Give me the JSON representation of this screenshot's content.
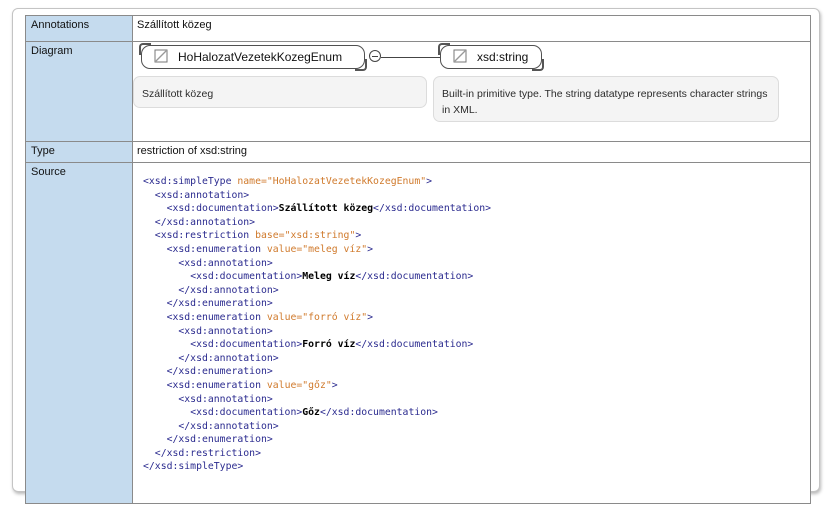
{
  "rows": {
    "annotations": {
      "label": "Annotations",
      "value": "Szállított közeg"
    },
    "diagram": {
      "label": "Diagram",
      "type_name": "HoHalozatVezetekKozegEnum",
      "type_doc": "Szállított közeg",
      "base_type": "xsd:string",
      "base_doc": "Built-in primitive type. The string datatype represents character strings in XML."
    },
    "type": {
      "label": "Type",
      "value": "restriction of xsd:string"
    },
    "source": {
      "label": "Source"
    }
  },
  "source_lines": [
    {
      "indent": "",
      "parts": [
        [
          "tag",
          "<xsd:simpleType "
        ],
        [
          "attr",
          "name="
        ],
        [
          "attr",
          "\"HoHalozatVezetekKozegEnum\""
        ],
        [
          "tag",
          ">"
        ]
      ]
    },
    {
      "indent": "  ",
      "parts": [
        [
          "tag",
          "<xsd:annotation>"
        ]
      ]
    },
    {
      "indent": "    ",
      "parts": [
        [
          "tag",
          "<xsd:documentation>"
        ],
        [
          "txt",
          "Szállított közeg"
        ],
        [
          "tag",
          "</xsd:documentation>"
        ]
      ]
    },
    {
      "indent": "  ",
      "parts": [
        [
          "tag",
          "</xsd:annotation>"
        ]
      ]
    },
    {
      "indent": "  ",
      "parts": [
        [
          "tag",
          "<xsd:restriction "
        ],
        [
          "attr",
          "base="
        ],
        [
          "attr",
          "\"xsd:string\""
        ],
        [
          "tag",
          ">"
        ]
      ]
    },
    {
      "indent": "    ",
      "parts": [
        [
          "tag",
          "<xsd:enumeration "
        ],
        [
          "attr",
          "value="
        ],
        [
          "attr",
          "\"meleg víz\""
        ],
        [
          "tag",
          ">"
        ]
      ]
    },
    {
      "indent": "      ",
      "parts": [
        [
          "tag",
          "<xsd:annotation>"
        ]
      ]
    },
    {
      "indent": "        ",
      "parts": [
        [
          "tag",
          "<xsd:documentation>"
        ],
        [
          "txt",
          "Meleg víz"
        ],
        [
          "tag",
          "</xsd:documentation>"
        ]
      ]
    },
    {
      "indent": "      ",
      "parts": [
        [
          "tag",
          "</xsd:annotation>"
        ]
      ]
    },
    {
      "indent": "    ",
      "parts": [
        [
          "tag",
          "</xsd:enumeration>"
        ]
      ]
    },
    {
      "indent": "    ",
      "parts": [
        [
          "tag",
          "<xsd:enumeration "
        ],
        [
          "attr",
          "value="
        ],
        [
          "attr",
          "\"forró víz\""
        ],
        [
          "tag",
          ">"
        ]
      ]
    },
    {
      "indent": "      ",
      "parts": [
        [
          "tag",
          "<xsd:annotation>"
        ]
      ]
    },
    {
      "indent": "        ",
      "parts": [
        [
          "tag",
          "<xsd:documentation>"
        ],
        [
          "txt",
          "Forró víz"
        ],
        [
          "tag",
          "</xsd:documentation>"
        ]
      ]
    },
    {
      "indent": "      ",
      "parts": [
        [
          "tag",
          "</xsd:annotation>"
        ]
      ]
    },
    {
      "indent": "    ",
      "parts": [
        [
          "tag",
          "</xsd:enumeration>"
        ]
      ]
    },
    {
      "indent": "    ",
      "parts": [
        [
          "tag",
          "<xsd:enumeration "
        ],
        [
          "attr",
          "value="
        ],
        [
          "attr",
          "\"gőz\""
        ],
        [
          "tag",
          ">"
        ]
      ]
    },
    {
      "indent": "      ",
      "parts": [
        [
          "tag",
          "<xsd:annotation>"
        ]
      ]
    },
    {
      "indent": "        ",
      "parts": [
        [
          "tag",
          "<xsd:documentation>"
        ],
        [
          "txt",
          "Gőz"
        ],
        [
          "tag",
          "</xsd:documentation>"
        ]
      ]
    },
    {
      "indent": "      ",
      "parts": [
        [
          "tag",
          "</xsd:annotation>"
        ]
      ]
    },
    {
      "indent": "    ",
      "parts": [
        [
          "tag",
          "</xsd:enumeration>"
        ]
      ]
    },
    {
      "indent": "  ",
      "parts": [
        [
          "tag",
          "</xsd:restriction>"
        ]
      ]
    },
    {
      "indent": "",
      "parts": [
        [
          "tag",
          "</xsd:simpleType>"
        ]
      ]
    }
  ],
  "colors": {
    "key_bg": "#c5dbee",
    "tag": "#2b2b8f",
    "attr": "#d07a2c",
    "text": "#000000"
  }
}
